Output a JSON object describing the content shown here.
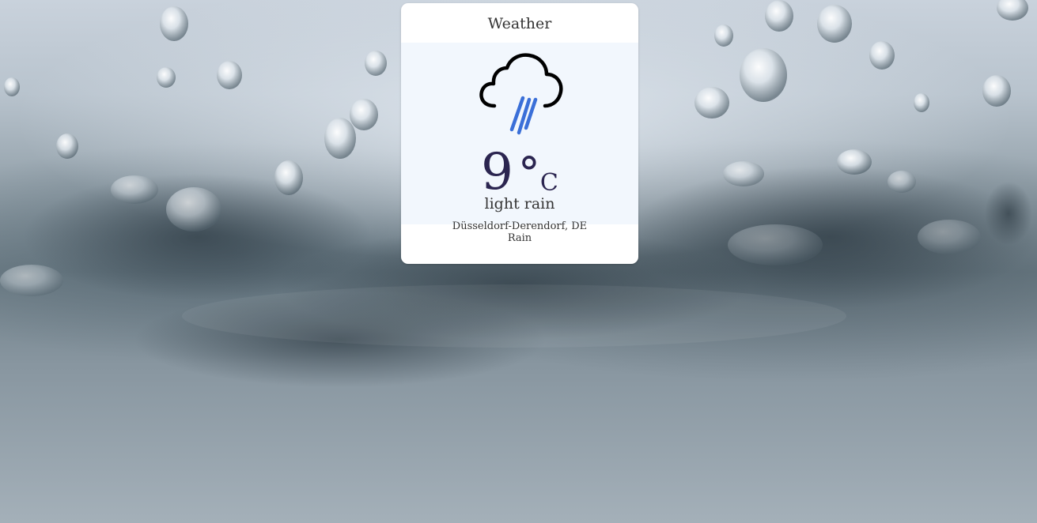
{
  "widget": {
    "title": "Weather",
    "icon": "rain-cloud-icon",
    "temperature": "9",
    "degree_symbol": "°",
    "unit": "C",
    "description": "light rain",
    "location": "Düsseldorf-Derendorf, DE",
    "condition": "Rain"
  },
  "background": {
    "icon": "water-splash-photo"
  },
  "colors": {
    "card_bg": "#ffffff",
    "panel_bg": "#f2f7fd",
    "temp_text": "#2b2550",
    "rain_streaks": "#3a6fd8",
    "cloud_outline": "#000000"
  }
}
